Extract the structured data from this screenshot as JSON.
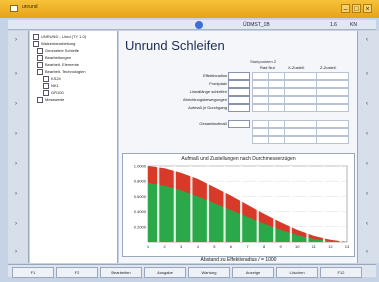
{
  "window": {
    "title": "unrund",
    "title_center": "ÜDMST_1B",
    "right_field_1": "1.6",
    "right_field_2": "KN"
  },
  "tree": {
    "items": [
      {
        "label": "UNRUND - Unrd (TY 1.0)"
      },
      {
        "label": "Walzenbearbeitung"
      },
      {
        "label": "Geometrie Schleife"
      },
      {
        "label": "Bearbeitungen"
      },
      {
        "label": "Bearbeit. Elemente"
      },
      {
        "label": "Bearbeit. Technologien"
      },
      {
        "label": "KS24"
      },
      {
        "label": "NK1"
      },
      {
        "label": "GR100"
      },
      {
        "label": "Messwerte"
      }
    ]
  },
  "page": {
    "title": "Unrund Schleifen",
    "side_label": "Startpunkten Z",
    "params": [
      {
        "label": "Effektivradius"
      },
      {
        "label": "Frontplatz"
      },
      {
        "label": "Lineallänge schleifen"
      },
      {
        "label": "Abrichtungsbewegungen"
      },
      {
        "label": "Aufmaß je Durchgang"
      },
      {
        "label": "Gesamtaufmaß"
      }
    ],
    "cols": [
      "Rad Nut",
      "X-Zustell.",
      "Z-Zustell."
    ]
  },
  "chart_data": {
    "type": "area",
    "title": "Aufmaß und Zustellungen nach Durchmesserzügen",
    "xlabel": "Abstand zu Effektivradius / = 1000",
    "x": [
      1,
      2,
      3,
      4,
      5,
      6,
      7,
      8,
      9,
      10,
      11,
      12,
      13
    ],
    "series": [
      {
        "name": "",
        "color": "#d83a2a",
        "values": [
          1.0,
          0.97,
          0.91,
          0.83,
          0.72,
          0.61,
          0.49,
          0.37,
          0.26,
          0.16,
          0.08,
          0.03,
          0.0
        ]
      },
      {
        "name": "",
        "color": "#2aa84a",
        "values": [
          0.78,
          0.74,
          0.68,
          0.6,
          0.51,
          0.42,
          0.33,
          0.24,
          0.16,
          0.09,
          0.04,
          0.01,
          0.0
        ]
      }
    ],
    "ylim": [
      0,
      1.0
    ],
    "y_ticks": [
      "1.0000",
      "0.8000",
      "0.6000",
      "0.4000",
      "0.2000"
    ]
  },
  "bottombar": {
    "buttons": [
      "F1",
      "F2",
      "Bearbeiten",
      "Ausgabe",
      "Wartung",
      "Anzeige",
      "Löschen",
      "F12"
    ]
  },
  "colors": {
    "title_bg": "#f0b02e",
    "chart_red": "#d83a2a",
    "chart_green": "#2aa84a"
  }
}
